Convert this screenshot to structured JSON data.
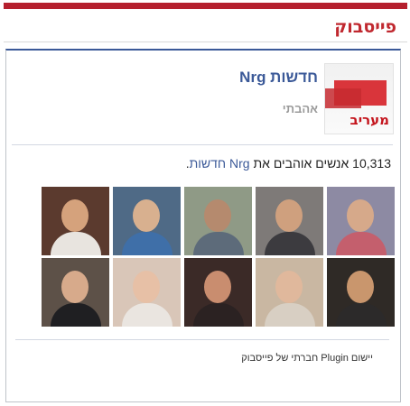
{
  "widget": {
    "title": "פייסבוק"
  },
  "page": {
    "name": "חדשות Nrg",
    "like_label": "אהבתי",
    "thumbnail_logo": "מעריב"
  },
  "likes": {
    "count": "10,313",
    "text": " אנשים אוהבים את ",
    "page_link": "Nrg חדשות",
    "end": "."
  },
  "faces": [
    {
      "bg": "#8d8aa3",
      "skin": "#d6a98a",
      "cloth": "#c45f6d"
    },
    {
      "bg": "#7e7a78",
      "skin": "#cfa07e",
      "cloth": "#3c3b3f"
    },
    {
      "bg": "#8f9a86",
      "skin": "#b58a6e",
      "cloth": "#5d6b7a"
    },
    {
      "bg": "#4f6a86",
      "skin": "#d8b08f",
      "cloth": "#3f6fa8"
    },
    {
      "bg": "#5b3a2e",
      "skin": "#d5a27c",
      "cloth": "#e8e4df"
    },
    {
      "bg": "#2f2a26",
      "skin": "#c9966d",
      "cloth": "#2c2a2a"
    },
    {
      "bg": "#c9b7a2",
      "skin": "#e0b89c",
      "cloth": "#d8cfc3"
    },
    {
      "bg": "#3b2a27",
      "skin": "#c98d6f",
      "cloth": "#2b2222"
    },
    {
      "bg": "#d9c6b8",
      "skin": "#e7c0a6",
      "cloth": "#eae5e0"
    },
    {
      "bg": "#5d5148",
      "skin": "#d7aa8b",
      "cloth": "#1f1f22"
    }
  ],
  "footer": {
    "plugin_text": "יישום Plugin חברתי של פייסבוק"
  }
}
